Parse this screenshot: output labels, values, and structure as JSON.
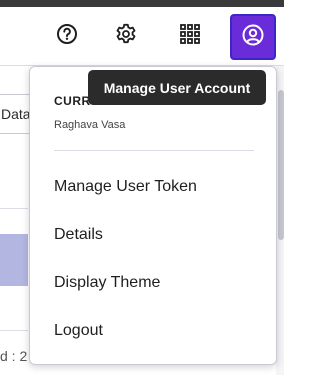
{
  "toolbar": {
    "icons": [
      "help-icon",
      "gear-icon",
      "apps-grid-icon",
      "user-account-icon"
    ],
    "account_button_color": "#6a2bd9"
  },
  "background": {
    "column_header_partial": "Data",
    "footer_partial": "d : 2"
  },
  "tooltip": {
    "text": "Manage User Account"
  },
  "menu": {
    "current_label": "CURR",
    "current_user": "Raghava Vasa",
    "items": [
      {
        "label": "Manage User Token"
      },
      {
        "label": "Details"
      },
      {
        "label": "Display Theme"
      },
      {
        "label": "Logout"
      }
    ]
  }
}
